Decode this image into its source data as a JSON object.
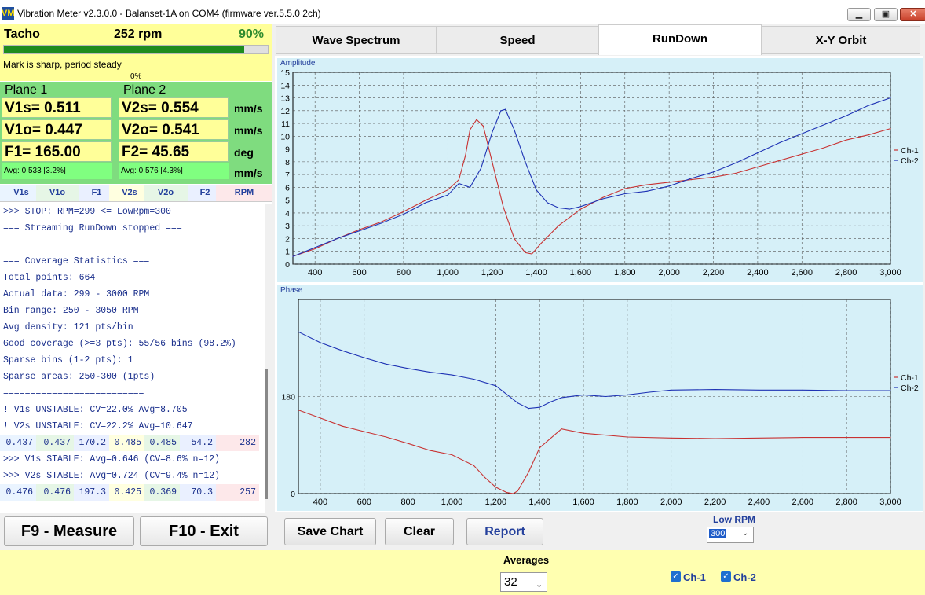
{
  "window": {
    "title": "Vibration Meter v2.3.0.0 - Balanset-1A on COM4 (firmware ver.5.5.0 2ch)",
    "app_icon": "VM"
  },
  "tacho": {
    "label": "Tacho",
    "rpm": "252 rpm",
    "percent": "90%",
    "fill": 0.91,
    "status": "Mark is sharp, period steady",
    "secondary_percent": "0%"
  },
  "plane1": {
    "title": "Plane 1",
    "v1s": "V1s= 0.511",
    "v1o": "V1o= 0.447",
    "f1": "F1= 165.00",
    "avg": "Avg: 0.533 [3.2%]"
  },
  "plane2": {
    "title": "Plane 2",
    "v2s": "V2s= 0.554",
    "v2o": "V2o= 0.541",
    "f2": "F2= 45.65",
    "avg": "Avg: 0.576 [4.3%]"
  },
  "units": {
    "u1": "mm/s",
    "u2": "mm/s",
    "u3": "deg",
    "u4": "mm/s"
  },
  "columns": [
    "V1s",
    "V1o",
    "F1",
    "V2s",
    "V2o",
    "F2",
    "RPM"
  ],
  "log": [
    ">>> STOP: RPM=299 <= LowRpm=300",
    "=== Streaming RunDown stopped ===",
    "",
    "=== Coverage Statistics ===",
    "Total points: 664",
    "Actual data: 299 - 3000 RPM",
    "Bin range: 250 - 3050 RPM",
    "Avg density: 121 pts/bin",
    "Good coverage (>=3 pts): 55/56 bins (98.2%)",
    "Sparse bins (1-2 pts): 1",
    "Sparse areas: 250-300 (1pts)",
    "==========================",
    "! V1s UNSTABLE: CV=22.0% Avg=8.705",
    "! V2s UNSTABLE: CV=22.2% Avg=10.647"
  ],
  "data_row1": [
    "0.437",
    "0.437",
    "170.2",
    "0.485",
    "0.485",
    "54.2",
    "282"
  ],
  "log2": [
    ">>> V1s STABLE: Avg=0.646 (CV=8.6% n=12)",
    ">>> V2s STABLE: Avg=0.724 (CV=9.4% n=12)"
  ],
  "data_row2": [
    "0.476",
    "0.476",
    "197.3",
    "0.425",
    "0.369",
    "70.3",
    "257"
  ],
  "buttons": {
    "measure": "F9 - Measure",
    "exit": "F10 - Exit",
    "save_chart": "Save Chart",
    "clear": "Clear",
    "report": "Report"
  },
  "tabs": [
    "Wave Spectrum",
    "Speed",
    "RunDown",
    "X-Y Orbit"
  ],
  "active_tab": "RunDown",
  "low_rpm": {
    "label": "Low RPM",
    "value": "300"
  },
  "averages": {
    "label": "Averages",
    "value": "32"
  },
  "checks": [
    {
      "label": "Ch-1",
      "checked": true
    },
    {
      "label": "Ch-2",
      "checked": true
    }
  ],
  "colors": {
    "ch1": "#c83232",
    "ch2": "#1e32b4",
    "chart_bg": "#d6f0f8",
    "tacho_bg": "#ffff99",
    "plane_bg": "#7fdc7f"
  },
  "chart_data": [
    {
      "type": "line",
      "title": "Amplitude",
      "x_ticks": [
        "400",
        "600",
        "800",
        "1,000",
        "1,200",
        "1,400",
        "1,600",
        "1,800",
        "2,000",
        "2,200",
        "2,400",
        "2,600",
        "2,800",
        "3,000"
      ],
      "y_ticks": [
        "0",
        "1",
        "2",
        "3",
        "4",
        "5",
        "6",
        "7",
        "8",
        "9",
        "10",
        "11",
        "12",
        "13",
        "14",
        "15"
      ],
      "xlim": [
        300,
        3000
      ],
      "ylim": [
        0,
        15
      ],
      "legend": [
        "Ch-1",
        "Ch-2"
      ],
      "series": [
        {
          "name": "Ch-1",
          "x": [
            300,
            400,
            500,
            600,
            700,
            800,
            900,
            1000,
            1050,
            1080,
            1100,
            1130,
            1160,
            1200,
            1250,
            1300,
            1350,
            1380,
            1420,
            1500,
            1600,
            1700,
            1800,
            1900,
            2000,
            2100,
            2200,
            2300,
            2400,
            2500,
            2600,
            2700,
            2800,
            2900,
            3000
          ],
          "y": [
            0.6,
            1.2,
            2.0,
            2.7,
            3.3,
            4.1,
            5.0,
            5.8,
            6.6,
            8.5,
            10.5,
            11.3,
            10.8,
            8.0,
            4.5,
            2.0,
            0.9,
            0.8,
            1.6,
            3.0,
            4.3,
            5.2,
            5.9,
            6.2,
            6.4,
            6.6,
            6.8,
            7.1,
            7.6,
            8.1,
            8.6,
            9.1,
            9.7,
            10.1,
            10.6
          ]
        },
        {
          "name": "Ch-2",
          "x": [
            300,
            400,
            500,
            600,
            700,
            800,
            900,
            1000,
            1050,
            1100,
            1150,
            1200,
            1240,
            1260,
            1300,
            1350,
            1400,
            1450,
            1500,
            1550,
            1600,
            1700,
            1800,
            1900,
            2000,
            2100,
            2200,
            2300,
            2400,
            2500,
            2600,
            2700,
            2800,
            2900,
            3000
          ],
          "y": [
            0.6,
            1.3,
            2.0,
            2.6,
            3.2,
            3.9,
            4.8,
            5.4,
            6.3,
            6.0,
            7.5,
            10.3,
            12.0,
            12.1,
            10.5,
            8.0,
            5.8,
            4.8,
            4.4,
            4.3,
            4.5,
            5.1,
            5.5,
            5.7,
            6.1,
            6.7,
            7.2,
            7.9,
            8.7,
            9.5,
            10.2,
            10.9,
            11.6,
            12.4,
            13.0
          ]
        }
      ]
    },
    {
      "type": "line",
      "title": "Phase",
      "x_ticks": [
        "400",
        "600",
        "800",
        "1,000",
        "1,200",
        "1,400",
        "1,600",
        "1,800",
        "2,000",
        "2,200",
        "2,400",
        "2,600",
        "2,800",
        "3,000"
      ],
      "y_ticks": [
        "0",
        "180"
      ],
      "xlim": [
        300,
        3000
      ],
      "ylim": [
        0,
        360
      ],
      "legend": [
        "Ch-1",
        "Ch-2"
      ],
      "series": [
        {
          "name": "Ch-1",
          "x": [
            300,
            400,
            500,
            600,
            700,
            800,
            900,
            1000,
            1100,
            1150,
            1200,
            1250,
            1280,
            1300,
            1350,
            1400,
            1500,
            1600,
            1800,
            2000,
            2200,
            2400,
            2600,
            2800,
            3000
          ],
          "y": [
            155,
            140,
            125,
            115,
            105,
            93,
            80,
            72,
            52,
            30,
            12,
            2,
            0,
            5,
            40,
            85,
            120,
            112,
            105,
            103,
            102,
            103,
            104,
            104,
            104
          ]
        },
        {
          "name": "Ch-2",
          "x": [
            300,
            400,
            500,
            600,
            700,
            800,
            900,
            1000,
            1100,
            1200,
            1300,
            1350,
            1400,
            1450,
            1500,
            1600,
            1700,
            1800,
            1900,
            2000,
            2200,
            2400,
            2600,
            2800,
            3000
          ],
          "y": [
            300,
            280,
            265,
            252,
            240,
            232,
            225,
            220,
            212,
            200,
            168,
            158,
            160,
            170,
            178,
            183,
            180,
            183,
            188,
            192,
            193,
            192,
            192,
            191,
            191
          ]
        }
      ]
    }
  ]
}
